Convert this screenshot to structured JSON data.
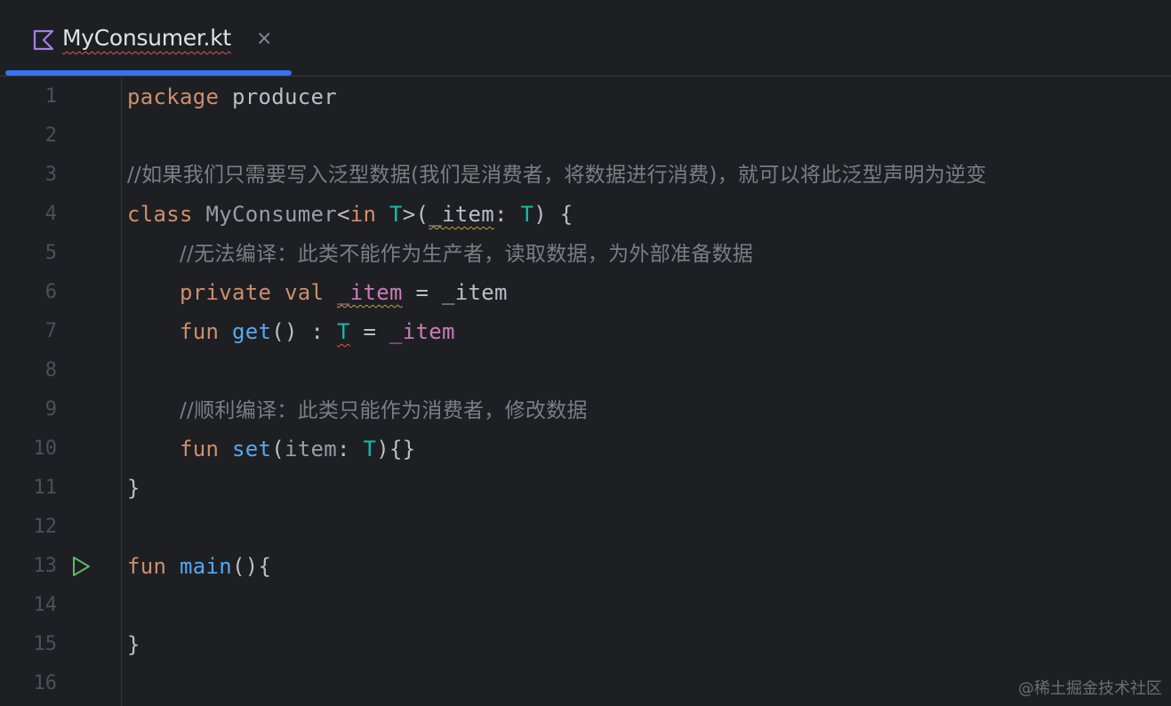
{
  "tab": {
    "title": "MyConsumer.kt",
    "close_glyph": "×",
    "icon": "kotlin-file-icon"
  },
  "lines": [
    {
      "num": "1"
    },
    {
      "num": "2"
    },
    {
      "num": "3"
    },
    {
      "num": "4"
    },
    {
      "num": "5"
    },
    {
      "num": "6"
    },
    {
      "num": "7"
    },
    {
      "num": "8"
    },
    {
      "num": "9"
    },
    {
      "num": "10"
    },
    {
      "num": "11"
    },
    {
      "num": "12"
    },
    {
      "num": "13"
    },
    {
      "num": "14"
    },
    {
      "num": "15"
    },
    {
      "num": "16"
    }
  ],
  "code": {
    "l1": {
      "kw": "package",
      "rest": " producer"
    },
    "l3": {
      "comment": "//如果我们只需要写入泛型数据(我们是消费者，将数据进行消费)，就可以将此泛型声明为逆变"
    },
    "l4": {
      "kw_class": "class",
      "name": " MyConsumer",
      "lt": "<",
      "kw_in": "in",
      "sp": " ",
      "t1": "T",
      "gt_paren": ">(",
      "param": "_item",
      "colon": ": ",
      "t2": "T",
      "close": ") {"
    },
    "l5": {
      "indent": "    ",
      "comment": "//无法编译：此类不能作为生产者，读取数据，为外部准备数据"
    },
    "l6": {
      "indent": "    ",
      "kw_private": "private",
      "sp1": " ",
      "kw_val": "val",
      "sp2": " ",
      "prop": "_item",
      "assign": " = _item"
    },
    "l7": {
      "indent": "    ",
      "kw_fun": "fun",
      "sp": " ",
      "fn": "get",
      "parens": "() : ",
      "typ": "T",
      "assign": " = ",
      "prop": "_item"
    },
    "l9": {
      "indent": "    ",
      "comment": "//顺利编译：此类只能作为消费者，修改数据"
    },
    "l10": {
      "indent": "    ",
      "kw_fun": "fun",
      "sp": " ",
      "fn": "set",
      "open": "(",
      "param": "item",
      "colon": ": ",
      "typ": "T",
      "close": "){}"
    },
    "l11": {
      "text": "}"
    },
    "l13": {
      "kw_fun": "fun",
      "sp": " ",
      "fn": "main",
      "rest": "(){"
    },
    "l15": {
      "text": "}"
    }
  },
  "gutter": {
    "run_icon": "run-triangle-icon"
  },
  "watermark": "@稀土掘金技术社区",
  "colors": {
    "background": "#1e1f22",
    "keyword": "#cf8e6d",
    "type_param": "#16baac",
    "function": "#56a8f5",
    "property": "#c77dbb",
    "comment": "#7a7e85",
    "accent": "#3574f0"
  }
}
